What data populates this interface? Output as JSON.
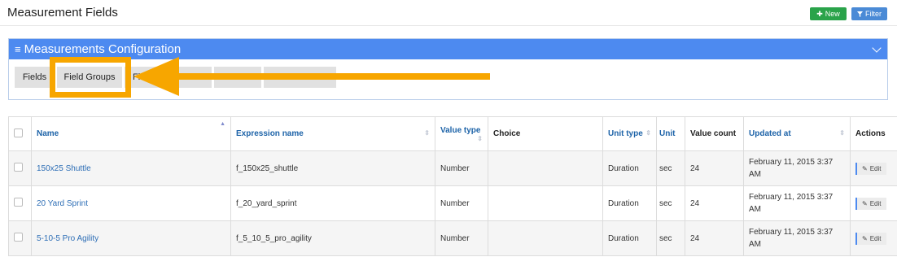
{
  "header": {
    "title": "Measurement Fields",
    "new_label": "New",
    "filter_label": "Filter"
  },
  "panel": {
    "title": "Measurements Configuration",
    "tabs": [
      "Fields",
      "Field Groups",
      "Fi",
      "",
      "",
      ""
    ]
  },
  "table": {
    "columns": [
      "Name",
      "Expression name",
      "Value type",
      "Choice",
      "Unit type",
      "Unit",
      "Value count",
      "Updated at",
      "Actions"
    ],
    "rows": [
      {
        "name": "150x25 Shuttle",
        "expression": "f_150x25_shuttle",
        "value_type": "Number",
        "choice": "",
        "unit_type": "Duration",
        "unit": "sec",
        "value_count": "24",
        "updated_at": "February 11, 2015 3:37 AM",
        "action": "Edit"
      },
      {
        "name": "20 Yard Sprint",
        "expression": "f_20_yard_sprint",
        "value_type": "Number",
        "choice": "",
        "unit_type": "Duration",
        "unit": "sec",
        "value_count": "24",
        "updated_at": "February 11, 2015 3:37 AM",
        "action": "Edit"
      },
      {
        "name": "5-10-5 Pro Agility",
        "expression": "f_5_10_5_pro_agility",
        "value_type": "Number",
        "choice": "",
        "unit_type": "Duration",
        "unit": "sec",
        "value_count": "24",
        "updated_at": "February 11, 2015 3:37 AM",
        "action": "Edit"
      }
    ]
  },
  "annotation": {
    "color": "#f7a600",
    "icon": "arrow-left-icon"
  },
  "colors": {
    "panel_header": "#4d8af0",
    "new_button": "#2aa34a",
    "filter_button": "#4a8ad6"
  }
}
